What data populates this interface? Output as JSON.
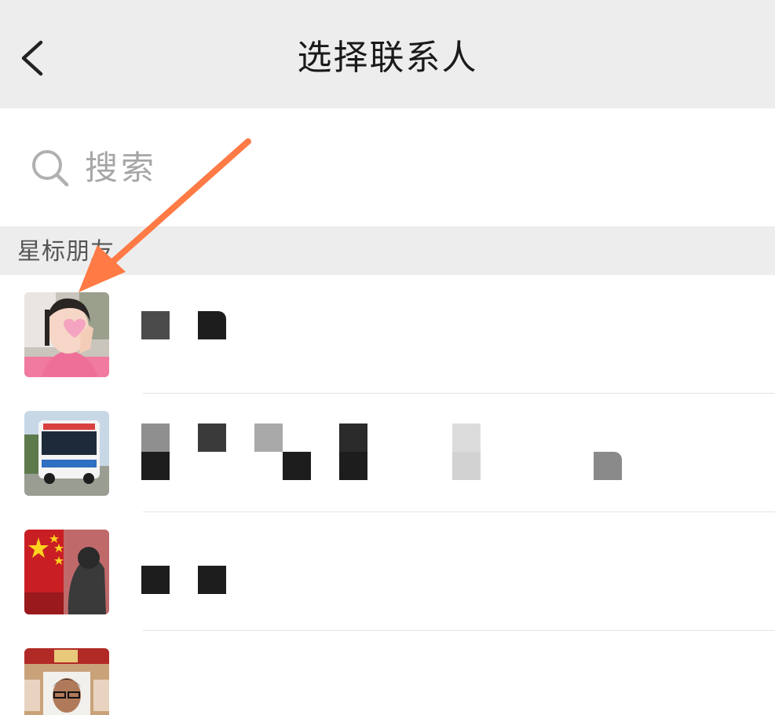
{
  "header": {
    "title": "选择联系人",
    "back_icon": "chevron-left-icon",
    "background": "#ededed"
  },
  "search": {
    "placeholder": "搜索",
    "icon": "search-icon"
  },
  "sections": [
    {
      "title": "星标朋友",
      "contacts": [
        {
          "avatar_desc": "avatar-photo-girl-pink"
        },
        {
          "avatar_desc": "avatar-photo-bus"
        },
        {
          "avatar_desc": "avatar-photo-flag"
        },
        {
          "avatar_desc": "avatar-photo-man-glasses"
        }
      ]
    }
  ],
  "annotation": {
    "type": "arrow",
    "color": "#ff7a45"
  }
}
